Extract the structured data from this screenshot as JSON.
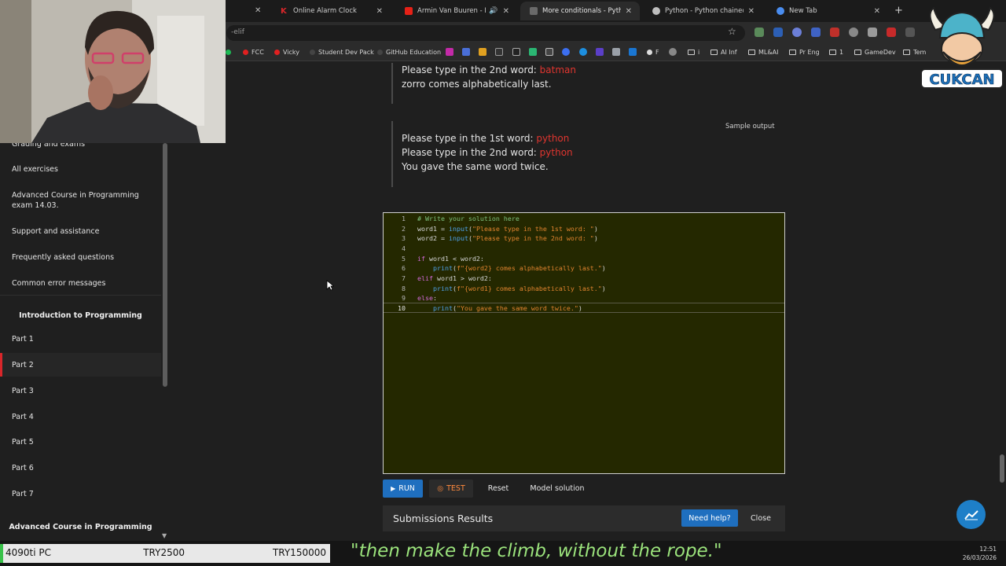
{
  "browser": {
    "tabs": [
      {
        "label": "Online Alarm Clock",
        "favicon_color": "#d9262a"
      },
      {
        "label": "Armin Van Buuren - Mirage",
        "favicon_color": "#e62117"
      },
      {
        "label": "More conditionals - Python Pro",
        "favicon_color": "#777777"
      },
      {
        "label": "Python - Python chained comp",
        "favicon_color": "#cccccc"
      },
      {
        "label": "New Tab",
        "favicon_color": "#4a8df0"
      }
    ],
    "url": "-elif",
    "bookmarks": [
      "FCC",
      "Vicky",
      "Student Dev Pack",
      "GitHub Education",
      "F",
      "i",
      "AI Inf",
      "ML&AI",
      "Pr Eng",
      "1",
      "GameDev",
      "Tem"
    ]
  },
  "logo_text": "CUKCAN",
  "sidebar": {
    "items_top": [
      "Grading and exams",
      "All exercises",
      "Advanced Course in Programming exam 14.03.",
      "Support and assistance",
      "Frequently asked questions",
      "Common error messages"
    ],
    "section1": "Introduction to Programming",
    "parts": [
      "Part 1",
      "Part 2",
      "Part 3",
      "Part 4",
      "Part 5",
      "Part 6",
      "Part 7"
    ],
    "section2": "Advanced Course in Programming"
  },
  "main": {
    "block1": {
      "line1_prefix": "Please type in the 2nd word: ",
      "line1_value": "batman",
      "line2": "zorro comes alphabetically last."
    },
    "block2": {
      "tag": "Sample output",
      "line1_prefix": "Please type in the 1st word: ",
      "line1_value": "python",
      "line2_prefix": "Please type in the 2nd word: ",
      "line2_value": "python",
      "line3": "You gave the same word twice."
    },
    "code_lines": [
      "1",
      "2",
      "3",
      "4",
      "5",
      "6",
      "7",
      "8",
      "9",
      "10"
    ],
    "buttons": {
      "run": "RUN",
      "test": "TEST",
      "reset": "Reset",
      "model": "Model solution"
    },
    "submissions": {
      "title": "Submissions Results",
      "help": "Need help?",
      "close": "Close"
    }
  },
  "overlay": {
    "stat1": "4090ti PC",
    "stat2": "TRY2500",
    "stat3": "TRY150000",
    "quote": "\"then make the climb, without the rope.\"",
    "time": "12:51",
    "date": "26/03/2026"
  }
}
